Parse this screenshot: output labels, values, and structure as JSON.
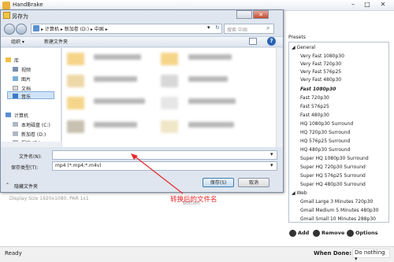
{
  "app": {
    "title": "HandBrake",
    "status": "Ready",
    "when_done_label": "When Done:",
    "when_done_value": "Do nothing",
    "background_text_1": "Display Size 1920x1080,  PAR 1x1",
    "background_text_2": "Bottom"
  },
  "presets": {
    "title": "Presets",
    "groups": [
      {
        "name": "General",
        "items": [
          {
            "label": "Very Fast 1080p30",
            "selected": false
          },
          {
            "label": "Very Fast 720p30",
            "selected": false
          },
          {
            "label": "Very Fast 576p25",
            "selected": false
          },
          {
            "label": "Very Fast 480p30",
            "selected": false
          },
          {
            "label": "Fast 1080p30",
            "selected": true
          },
          {
            "label": "Fast 720p30",
            "selected": false
          },
          {
            "label": "Fast 576p25",
            "selected": false
          },
          {
            "label": "Fast 480p30",
            "selected": false
          },
          {
            "label": "HQ 1080p30 Surround",
            "selected": false
          },
          {
            "label": "HQ 720p30 Surround",
            "selected": false
          },
          {
            "label": "HQ 576p25 Surround",
            "selected": false
          },
          {
            "label": "HQ 480p30 Surround",
            "selected": false
          },
          {
            "label": "Super HQ 1080p30 Surround",
            "selected": false
          },
          {
            "label": "Super HQ 720p30 Surround",
            "selected": false
          },
          {
            "label": "Super HQ 576p25 Surround",
            "selected": false
          },
          {
            "label": "Super HQ 480p30 Surround",
            "selected": false
          }
        ]
      },
      {
        "name": "Web",
        "items": [
          {
            "label": "Gmail Large 3 Minutes 720p30",
            "selected": false
          },
          {
            "label": "Gmail Medium 5 Minutes 480p30",
            "selected": false
          },
          {
            "label": "Gmail Small 10 Minutes 288p30",
            "selected": false
          }
        ]
      }
    ],
    "actions": {
      "add": "Add",
      "remove": "Remove",
      "options": "Options"
    }
  },
  "dialog": {
    "title": "另存为",
    "address": "▸ 计算机 ▸ 新加卷 (D:) ▸ 中国 ▸",
    "search_placeholder": "搜索 中国",
    "toolbar": {
      "organize": "组织 ▾",
      "new_folder": "新建文件夹"
    },
    "nav": {
      "library": "库",
      "video": "视频",
      "pictures": "图片",
      "documents": "文档",
      "music": "音乐",
      "computer": "计算机",
      "local_c": "本地磁盘 (C:)",
      "new_d": "新加卷 (D:)",
      "prog_e": "程序 (E:)"
    },
    "filename_label": "文件名(N):",
    "filename_value": "",
    "filetype_label": "保存类型(T):",
    "filetype_value": "mp4 (*.mp4;*.m4v)",
    "hide_folders": "隐藏文件夹",
    "save_button": "保存(S)",
    "cancel_button": "取消"
  },
  "annotation": {
    "text": "转换后的文件名",
    "color": "#e8262a"
  }
}
